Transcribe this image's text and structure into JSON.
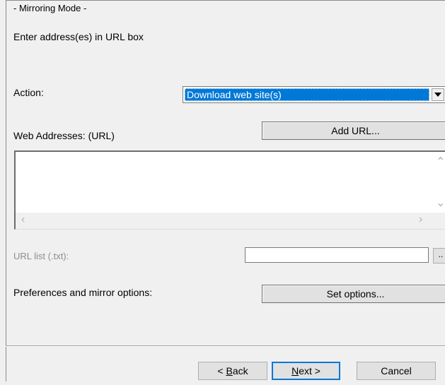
{
  "panel": {
    "group_title": "- Mirroring Mode -",
    "instruction": "Enter address(es) in URL box"
  },
  "action": {
    "label": "Action:",
    "selected": "Download web site(s)"
  },
  "web_addresses": {
    "label": "Web Addresses: (URL)",
    "add_url_button": "Add URL...",
    "value": ""
  },
  "url_list": {
    "label": "URL list (.txt):",
    "value": "",
    "browse_button": ".."
  },
  "preferences": {
    "label": "Preferences and mirror options:",
    "set_options_button": "Set options..."
  },
  "footer": {
    "back_prefix": "< ",
    "back_mnemonic": "B",
    "back_rest": "ack",
    "next_mnemonic": "N",
    "next_rest": "ext >",
    "cancel_label": "Cancel"
  },
  "icons": {
    "dropdown": "chevron-down-icon",
    "scroll_up": "scroll-up-icon",
    "scroll_down": "scroll-down-icon",
    "scroll_left": "scroll-left-icon",
    "scroll_right": "scroll-right-icon"
  },
  "colors": {
    "background": "#f0f0f0",
    "selection": "#0078d7",
    "disabled_text": "#8d8d8d"
  }
}
